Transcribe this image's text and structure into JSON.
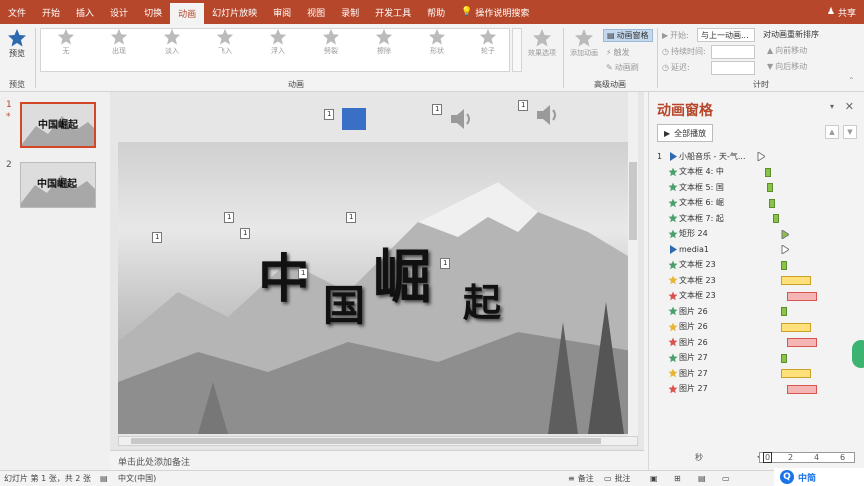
{
  "tabs": {
    "file": "文件",
    "items": [
      "开始",
      "插入",
      "设计",
      "切换",
      "动画",
      "幻灯片放映",
      "审阅",
      "视图",
      "录制",
      "开发工具",
      "帮助"
    ],
    "active": "动画",
    "tell_me": "操作说明搜索",
    "share": "共享"
  },
  "ribbon": {
    "preview": {
      "button": "预览",
      "group": "预览"
    },
    "animation": {
      "group": "动画",
      "effects": [
        "无",
        "出现",
        "淡入",
        "飞入",
        "浮入",
        "劈裂",
        "擦除",
        "形状",
        "轮子"
      ],
      "effect_options": "效果选项"
    },
    "advanced": {
      "group": "高级动画",
      "add_animation": "添加动画",
      "pane": "动画窗格",
      "trigger": "触发",
      "painter": "动画刷"
    },
    "timing": {
      "group": "计时",
      "start_label": "开始:",
      "start_value": "与上一动画...",
      "duration_label": "持续时间:",
      "delay_label": "延迟:",
      "reorder": "对动画重新排序",
      "forward": "向前移动",
      "backward": "向后移动"
    }
  },
  "slides": [
    {
      "num": "1",
      "marker": "*",
      "text": "中国崛起"
    },
    {
      "num": "2",
      "marker": "",
      "text": "中国崛起"
    }
  ],
  "slide": {
    "calligraphy": [
      "中",
      "国",
      "崛",
      "起"
    ],
    "tags": [
      "1",
      "1",
      "1",
      "1",
      "1",
      "1",
      "1",
      "1",
      "1"
    ]
  },
  "notes": {
    "placeholder": "单击此处添加备注"
  },
  "anim_pane": {
    "title": "动画窗格",
    "play_all": "全部播放",
    "items": [
      {
        "num": "1",
        "label": "小船音乐 - 天-气...",
        "icon": "play",
        "color": "#2e6ab0"
      },
      {
        "num": "",
        "label": "文本框 4: 中",
        "icon": "star",
        "color": "#4aa06a"
      },
      {
        "num": "",
        "label": "文本框 5: 国",
        "icon": "star",
        "color": "#4aa06a"
      },
      {
        "num": "",
        "label": "文本框 6: 崛",
        "icon": "star",
        "color": "#4aa06a"
      },
      {
        "num": "",
        "label": "文本框 7: 起",
        "icon": "star",
        "color": "#4aa06a"
      },
      {
        "num": "",
        "label": "矩形 24",
        "icon": "star",
        "color": "#4aa06a"
      },
      {
        "num": "",
        "label": "media1",
        "icon": "play",
        "color": "#2e6ab0"
      },
      {
        "num": "",
        "label": "文本框 23",
        "icon": "star",
        "color": "#4aa06a"
      },
      {
        "num": "",
        "label": "文本框 23",
        "icon": "star",
        "color": "#e8b431"
      },
      {
        "num": "",
        "label": "文本框 23",
        "icon": "star",
        "color": "#d9534f"
      },
      {
        "num": "",
        "label": "图片 26",
        "icon": "star",
        "color": "#4aa06a"
      },
      {
        "num": "",
        "label": "图片 26",
        "icon": "star",
        "color": "#e8b431"
      },
      {
        "num": "",
        "label": "图片 26",
        "icon": "star",
        "color": "#d9534f"
      },
      {
        "num": "",
        "label": "图片 27",
        "icon": "star",
        "color": "#4aa06a"
      },
      {
        "num": "",
        "label": "图片 27",
        "icon": "star",
        "color": "#e8b431"
      },
      {
        "num": "",
        "label": "图片 27",
        "icon": "star",
        "color": "#d9534f"
      }
    ],
    "timeline": {
      "unit": "秒",
      "ticks": [
        "0",
        "2",
        "4",
        "6"
      ]
    }
  },
  "status": {
    "slide_info": "幻灯片 第 1 张，共 2 张",
    "language": "中文(中国)",
    "notes": "备注",
    "comments": "批注"
  },
  "watermark": "中简"
}
